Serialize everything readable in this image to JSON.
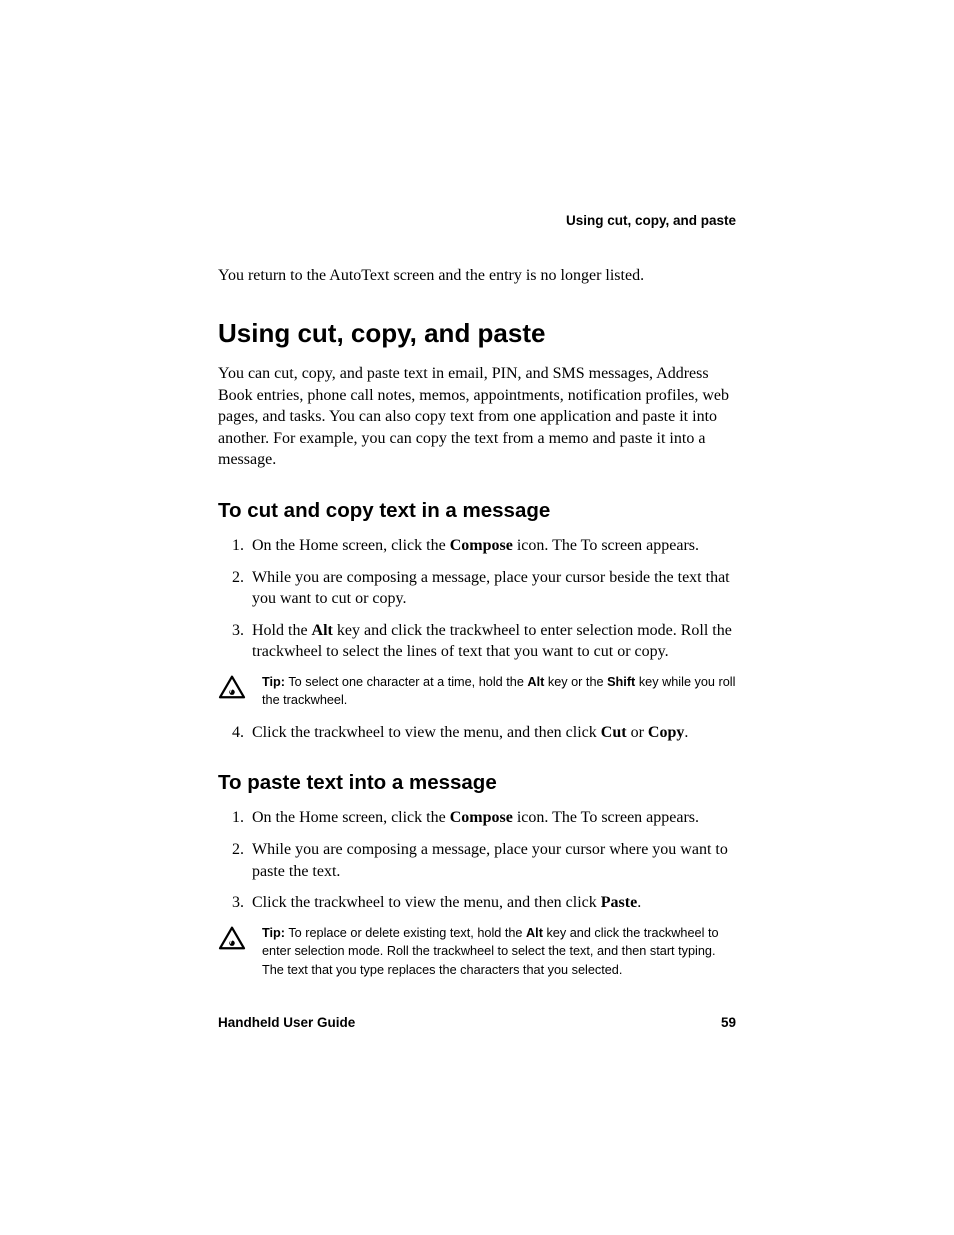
{
  "header": {
    "running_title": "Using cut, copy, and paste"
  },
  "intro_para": "You return to the AutoText screen and the entry is no longer listed.",
  "section": {
    "title": "Using cut, copy, and paste",
    "para": "You can cut, copy, and paste text in email, PIN, and SMS messages, Address Book entries, phone call notes, memos, appointments, notification profiles, web pages, and tasks. You can also copy text from one application and paste it into another. For example, you can copy the text from a memo and paste it into a message."
  },
  "sub1": {
    "title": "To cut and copy text in a message",
    "steps": {
      "s1_a": "On the Home screen, click the ",
      "s1_bold": "Compose",
      "s1_b": " icon. The To screen appears.",
      "s2": "While you are composing a message, place your cursor beside the text that you want to cut or copy.",
      "s3_a": "Hold the ",
      "s3_bold": "Alt",
      "s3_b": " key and click the trackwheel to enter selection mode. Roll the trackwheel to select the lines of text that you want to cut or copy.",
      "s4_a": "Click the trackwheel to view the menu, and then click ",
      "s4_bold1": "Cut",
      "s4_mid": " or ",
      "s4_bold2": "Copy",
      "s4_end": "."
    },
    "tip": {
      "label": "Tip:",
      "a": " To select one character at a time, hold the ",
      "bold1": "Alt",
      "mid1": " key or the ",
      "bold2": "Shift",
      "b": " key while you roll the trackwheel."
    }
  },
  "sub2": {
    "title": "To paste text into a message",
    "steps": {
      "s1_a": "On the Home screen, click the ",
      "s1_bold": "Compose",
      "s1_b": " icon. The To screen appears.",
      "s2": "While you are composing a message, place your cursor where you want to paste the text.",
      "s3_a": "Click the trackwheel to view the menu, and then click ",
      "s3_bold": "Paste",
      "s3_b": "."
    },
    "tip": {
      "label": "Tip:",
      "a": " To replace or delete existing text, hold the ",
      "bold1": "Alt",
      "b": " key and click the trackwheel to enter selection mode. Roll the trackwheel to select the text, and then start typing. The text that you type replaces the characters that you selected."
    }
  },
  "footer": {
    "book_title": "Handheld User Guide",
    "page_number": "59"
  }
}
